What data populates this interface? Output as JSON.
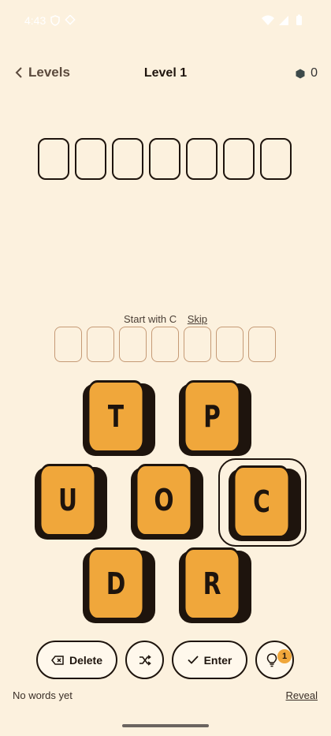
{
  "status_bar": {
    "time": "4:43"
  },
  "header": {
    "back_label": "Levels",
    "title": "Level 1",
    "coins": "0"
  },
  "answer": {
    "slot_count": 7
  },
  "hint_row": {
    "text": "Start with C",
    "skip_label": "Skip"
  },
  "tiles": [
    {
      "letter": "T",
      "selected": false
    },
    {
      "letter": "P",
      "selected": false
    },
    {
      "letter": "U",
      "selected": false
    },
    {
      "letter": "O",
      "selected": false
    },
    {
      "letter": "C",
      "selected": true
    },
    {
      "letter": "D",
      "selected": false
    },
    {
      "letter": "R",
      "selected": false
    }
  ],
  "controls": {
    "delete_label": "Delete",
    "enter_label": "Enter",
    "hint_count": "1"
  },
  "footer": {
    "words_status": "No words yet",
    "reveal_label": "Reveal"
  },
  "colors": {
    "background": "#FCF1DE",
    "tile": "#F0A73B",
    "outline": "#1E140D"
  },
  "icons": [
    "wifi-icon",
    "signal-icon",
    "battery-icon",
    "shield-icon",
    "chevron-left-icon",
    "hexagon-coin-icon",
    "backspace-icon",
    "shuffle-icon",
    "check-icon",
    "lightbulb-icon"
  ]
}
